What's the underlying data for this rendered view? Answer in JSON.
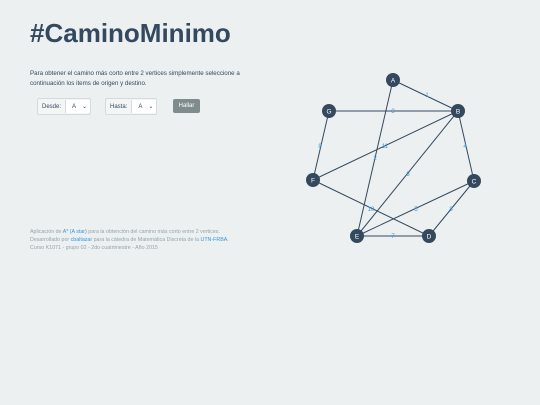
{
  "title": "#CaminoMinimo",
  "description": "Para obtener el camino más corto entre 2 vertices simplemente seleccione a continuación los items de origen y destino.",
  "from": {
    "label": "Desde:",
    "value": "A"
  },
  "to": {
    "label": "Hasta:",
    "value": "A"
  },
  "submit_label": "Hallar",
  "footer": {
    "line1_pre": "Aplicación de ",
    "line1_link": "A* (A star)",
    "line1_post": " para la obtención del camino más corto entre 2 vertices.",
    "line2_pre": "Desarrollado por ",
    "line2_link": "cbaltazar",
    "line2_mid": " para la cátedra de Matemática Discreta de la ",
    "line2_link2": "UTN-FRBA",
    "line2_post": ".",
    "line3": "Curso K1071 - grupo 02 - 2do cuatrimestre - Año 2015"
  },
  "graph": {
    "nodes": [
      "A",
      "B",
      "C",
      "D",
      "E",
      "F",
      "G"
    ],
    "edges": [
      {
        "from": "A",
        "to": "B",
        "weight": "1"
      },
      {
        "from": "G",
        "to": "B",
        "weight": "8"
      },
      {
        "from": "A",
        "to": "E",
        "weight": "2"
      },
      {
        "from": "G",
        "to": "F",
        "weight": "8"
      },
      {
        "from": "B",
        "to": "F",
        "weight": "11"
      },
      {
        "from": "B",
        "to": "C",
        "weight": "4"
      },
      {
        "from": "B",
        "to": "E",
        "weight": "3"
      },
      {
        "from": "C",
        "to": "E",
        "weight": "5"
      },
      {
        "from": "C",
        "to": "D",
        "weight": "8"
      },
      {
        "from": "F",
        "to": "D",
        "weight": "10"
      },
      {
        "from": "E",
        "to": "D",
        "weight": "7"
      }
    ]
  }
}
